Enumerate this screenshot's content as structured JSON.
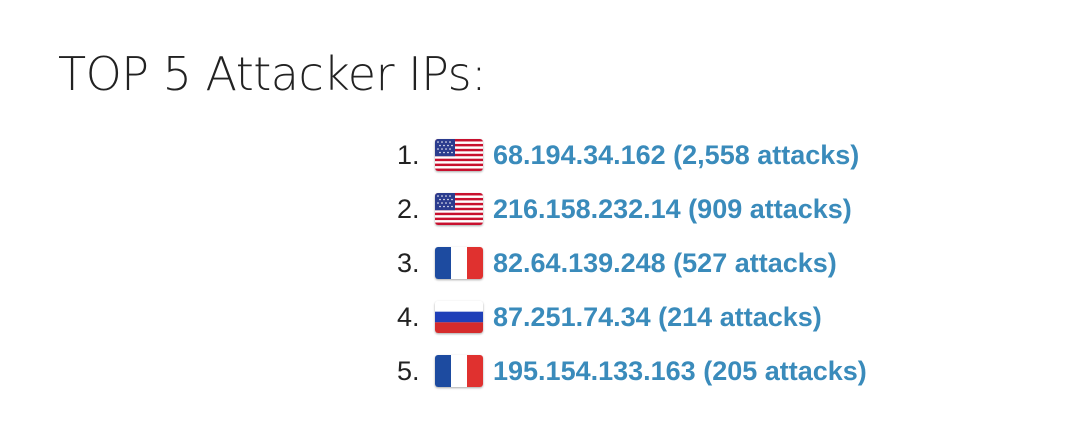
{
  "title": "TOP 5 Attacker IPs:",
  "colors": {
    "link": "#3a8bbb",
    "text": "#222222"
  },
  "attackers": [
    {
      "rank": "1.",
      "flag": "us-flag-icon",
      "label": "68.194.34.162 (2,558 attacks)"
    },
    {
      "rank": "2.",
      "flag": "us-flag-icon",
      "label": "216.158.232.14 (909 attacks)"
    },
    {
      "rank": "3.",
      "flag": "fr-flag-icon",
      "label": "82.64.139.248 (527 attacks)"
    },
    {
      "rank": "4.",
      "flag": "ru-flag-icon",
      "label": "87.251.74.34 (214 attacks)"
    },
    {
      "rank": "5.",
      "flag": "fr-flag-icon",
      "label": "195.154.133.163 (205 attacks)"
    }
  ]
}
